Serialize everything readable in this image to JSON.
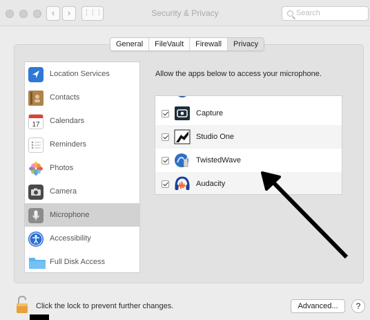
{
  "window": {
    "title": "Security & Privacy"
  },
  "search": {
    "placeholder": "Search"
  },
  "tabs": [
    {
      "label": "General",
      "selected": false
    },
    {
      "label": "FileVault",
      "selected": false
    },
    {
      "label": "Firewall",
      "selected": false
    },
    {
      "label": "Privacy",
      "selected": true
    }
  ],
  "sidebar": {
    "items": [
      {
        "label": "Location Services",
        "icon": "location-arrow-icon"
      },
      {
        "label": "Contacts",
        "icon": "contacts-book-icon"
      },
      {
        "label": "Calendars",
        "icon": "calendar-icon",
        "badge": "17"
      },
      {
        "label": "Reminders",
        "icon": "reminders-list-icon"
      },
      {
        "label": "Photos",
        "icon": "photos-flower-icon"
      },
      {
        "label": "Camera",
        "icon": "camera-icon"
      },
      {
        "label": "Microphone",
        "icon": "microphone-icon",
        "selected": true
      },
      {
        "label": "Accessibility",
        "icon": "accessibility-person-icon"
      },
      {
        "label": "Full Disk Access",
        "icon": "folder-icon"
      }
    ]
  },
  "panel": {
    "prompt": "Allow the apps below to access your microphone.",
    "apps": [
      {
        "name": "Capture",
        "checked": true,
        "icon": "capture-app-icon"
      },
      {
        "name": "Studio One",
        "checked": true,
        "icon": "studio-one-app-icon"
      },
      {
        "name": "TwistedWave",
        "checked": true,
        "icon": "twistedwave-app-icon"
      },
      {
        "name": "Audacity",
        "checked": true,
        "icon": "audacity-app-icon"
      }
    ]
  },
  "footer": {
    "lock_text": "Click the lock to prevent further changes.",
    "advanced_label": "Advanced...",
    "help_label": "?"
  },
  "colors": {
    "window_bg": "#ececec",
    "selected_row": "#d2d2d2",
    "annotation_arrow": "#000000"
  }
}
